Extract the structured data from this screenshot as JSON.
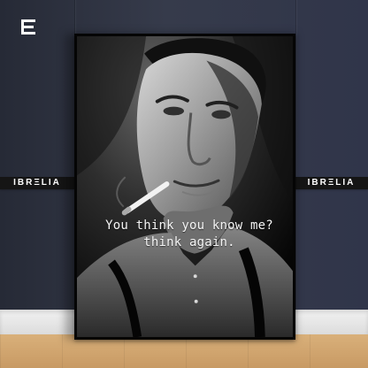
{
  "scene": {
    "brand_left": "IBRΞLIA",
    "brand_right": "IBRΞLIA",
    "poster_quote": "You think you know me?\nthink again.",
    "logo_icon": "e-shaped-logo-icon",
    "wall_color": "#353a4a",
    "poster_border_color": "#050505",
    "floor_color": "#d2a56d"
  }
}
